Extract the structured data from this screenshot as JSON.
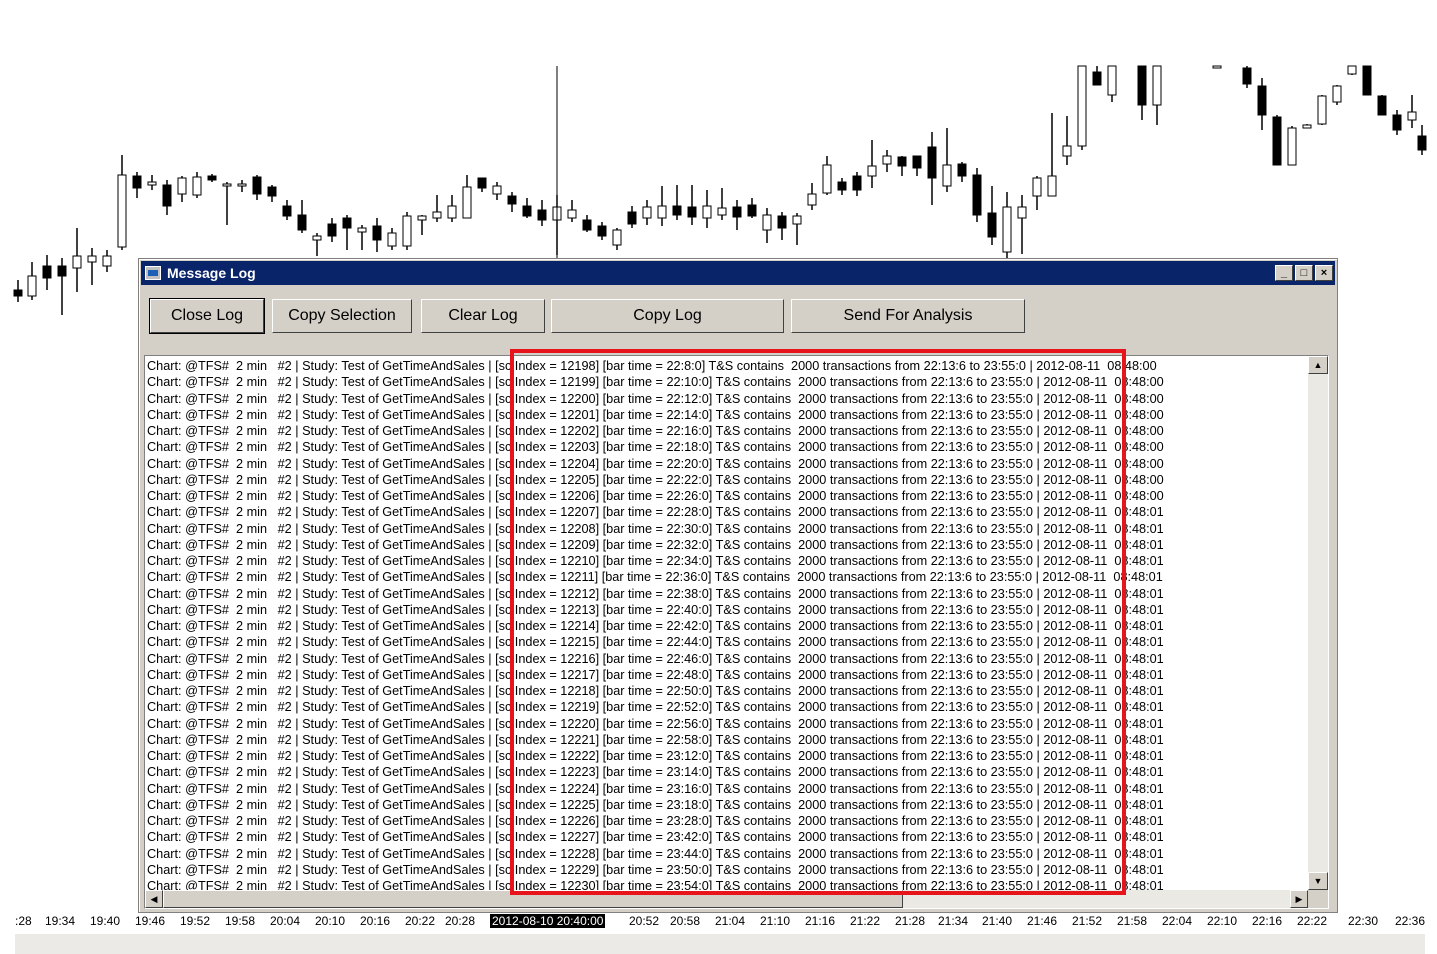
{
  "window": {
    "title": "Message Log",
    "minimize": "_",
    "maximize": "□",
    "close": "×"
  },
  "buttons": {
    "close_log": "Close Log",
    "copy_selection": "Copy Selection",
    "clear_log": "Clear Log",
    "copy_log": "Copy Log",
    "send_for_analysis": "Send For Analysis"
  },
  "scroll": {
    "up": "▲",
    "down": "▼",
    "left": "◀",
    "right": "▶"
  },
  "log": {
    "lines": [
      "Chart: @TFS#  2 min   #2 | Study: Test of GetTimeAndSales | [sc.Index = 12198] [bar time = 22:8:0] T&S contains  2000 transactions from 22:13:6 to 23:55:0 | 2012-08-11  08:48:00",
      "Chart: @TFS#  2 min   #2 | Study: Test of GetTimeAndSales | [sc.Index = 12199] [bar time = 22:10:0] T&S contains  2000 transactions from 22:13:6 to 23:55:0 | 2012-08-11  08:48:00",
      "Chart: @TFS#  2 min   #2 | Study: Test of GetTimeAndSales | [sc.Index = 12200] [bar time = 22:12:0] T&S contains  2000 transactions from 22:13:6 to 23:55:0 | 2012-08-11  08:48:00",
      "Chart: @TFS#  2 min   #2 | Study: Test of GetTimeAndSales | [sc.Index = 12201] [bar time = 22:14:0] T&S contains  2000 transactions from 22:13:6 to 23:55:0 | 2012-08-11  08:48:00",
      "Chart: @TFS#  2 min   #2 | Study: Test of GetTimeAndSales | [sc.Index = 12202] [bar time = 22:16:0] T&S contains  2000 transactions from 22:13:6 to 23:55:0 | 2012-08-11  08:48:00",
      "Chart: @TFS#  2 min   #2 | Study: Test of GetTimeAndSales | [sc.Index = 12203] [bar time = 22:18:0] T&S contains  2000 transactions from 22:13:6 to 23:55:0 | 2012-08-11  08:48:00",
      "Chart: @TFS#  2 min   #2 | Study: Test of GetTimeAndSales | [sc.Index = 12204] [bar time = 22:20:0] T&S contains  2000 transactions from 22:13:6 to 23:55:0 | 2012-08-11  08:48:00",
      "Chart: @TFS#  2 min   #2 | Study: Test of GetTimeAndSales | [sc.Index = 12205] [bar time = 22:22:0] T&S contains  2000 transactions from 22:13:6 to 23:55:0 | 2012-08-11  08:48:00",
      "Chart: @TFS#  2 min   #2 | Study: Test of GetTimeAndSales | [sc.Index = 12206] [bar time = 22:26:0] T&S contains  2000 transactions from 22:13:6 to 23:55:0 | 2012-08-11  08:48:00",
      "Chart: @TFS#  2 min   #2 | Study: Test of GetTimeAndSales | [sc.Index = 12207] [bar time = 22:28:0] T&S contains  2000 transactions from 22:13:6 to 23:55:0 | 2012-08-11  08:48:01",
      "Chart: @TFS#  2 min   #2 | Study: Test of GetTimeAndSales | [sc.Index = 12208] [bar time = 22:30:0] T&S contains  2000 transactions from 22:13:6 to 23:55:0 | 2012-08-11  08:48:01",
      "Chart: @TFS#  2 min   #2 | Study: Test of GetTimeAndSales | [sc.Index = 12209] [bar time = 22:32:0] T&S contains  2000 transactions from 22:13:6 to 23:55:0 | 2012-08-11  08:48:01",
      "Chart: @TFS#  2 min   #2 | Study: Test of GetTimeAndSales | [sc.Index = 12210] [bar time = 22:34:0] T&S contains  2000 transactions from 22:13:6 to 23:55:0 | 2012-08-11  08:48:01",
      "Chart: @TFS#  2 min   #2 | Study: Test of GetTimeAndSales | [sc.Index = 12211] [bar time = 22:36:0] T&S contains  2000 transactions from 22:13:6 to 23:55:0 | 2012-08-11  08:48:01",
      "Chart: @TFS#  2 min   #2 | Study: Test of GetTimeAndSales | [sc.Index = 12212] [bar time = 22:38:0] T&S contains  2000 transactions from 22:13:6 to 23:55:0 | 2012-08-11  08:48:01",
      "Chart: @TFS#  2 min   #2 | Study: Test of GetTimeAndSales | [sc.Index = 12213] [bar time = 22:40:0] T&S contains  2000 transactions from 22:13:6 to 23:55:0 | 2012-08-11  08:48:01",
      "Chart: @TFS#  2 min   #2 | Study: Test of GetTimeAndSales | [sc.Index = 12214] [bar time = 22:42:0] T&S contains  2000 transactions from 22:13:6 to 23:55:0 | 2012-08-11  08:48:01",
      "Chart: @TFS#  2 min   #2 | Study: Test of GetTimeAndSales | [sc.Index = 12215] [bar time = 22:44:0] T&S contains  2000 transactions from 22:13:6 to 23:55:0 | 2012-08-11  08:48:01",
      "Chart: @TFS#  2 min   #2 | Study: Test of GetTimeAndSales | [sc.Index = 12216] [bar time = 22:46:0] T&S contains  2000 transactions from 22:13:6 to 23:55:0 | 2012-08-11  08:48:01",
      "Chart: @TFS#  2 min   #2 | Study: Test of GetTimeAndSales | [sc.Index = 12217] [bar time = 22:48:0] T&S contains  2000 transactions from 22:13:6 to 23:55:0 | 2012-08-11  08:48:01",
      "Chart: @TFS#  2 min   #2 | Study: Test of GetTimeAndSales | [sc.Index = 12218] [bar time = 22:50:0] T&S contains  2000 transactions from 22:13:6 to 23:55:0 | 2012-08-11  08:48:01",
      "Chart: @TFS#  2 min   #2 | Study: Test of GetTimeAndSales | [sc.Index = 12219] [bar time = 22:52:0] T&S contains  2000 transactions from 22:13:6 to 23:55:0 | 2012-08-11  08:48:01",
      "Chart: @TFS#  2 min   #2 | Study: Test of GetTimeAndSales | [sc.Index = 12220] [bar time = 22:56:0] T&S contains  2000 transactions from 22:13:6 to 23:55:0 | 2012-08-11  08:48:01",
      "Chart: @TFS#  2 min   #2 | Study: Test of GetTimeAndSales | [sc.Index = 12221] [bar time = 22:58:0] T&S contains  2000 transactions from 22:13:6 to 23:55:0 | 2012-08-11  08:48:01",
      "Chart: @TFS#  2 min   #2 | Study: Test of GetTimeAndSales | [sc.Index = 12222] [bar time = 23:12:0] T&S contains  2000 transactions from 22:13:6 to 23:55:0 | 2012-08-11  08:48:01",
      "Chart: @TFS#  2 min   #2 | Study: Test of GetTimeAndSales | [sc.Index = 12223] [bar time = 23:14:0] T&S contains  2000 transactions from 22:13:6 to 23:55:0 | 2012-08-11  08:48:01",
      "Chart: @TFS#  2 min   #2 | Study: Test of GetTimeAndSales | [sc.Index = 12224] [bar time = 23:16:0] T&S contains  2000 transactions from 22:13:6 to 23:55:0 | 2012-08-11  08:48:01",
      "Chart: @TFS#  2 min   #2 | Study: Test of GetTimeAndSales | [sc.Index = 12225] [bar time = 23:18:0] T&S contains  2000 transactions from 22:13:6 to 23:55:0 | 2012-08-11  08:48:01",
      "Chart: @TFS#  2 min   #2 | Study: Test of GetTimeAndSales | [sc.Index = 12226] [bar time = 23:28:0] T&S contains  2000 transactions from 22:13:6 to 23:55:0 | 2012-08-11  08:48:01",
      "Chart: @TFS#  2 min   #2 | Study: Test of GetTimeAndSales | [sc.Index = 12227] [bar time = 23:42:0] T&S contains  2000 transactions from 22:13:6 to 23:55:0 | 2012-08-11  08:48:01",
      "Chart: @TFS#  2 min   #2 | Study: Test of GetTimeAndSales | [sc.Index = 12228] [bar time = 23:44:0] T&S contains  2000 transactions from 22:13:6 to 23:55:0 | 2012-08-11  08:48:01",
      "Chart: @TFS#  2 min   #2 | Study: Test of GetTimeAndSales | [sc.Index = 12229] [bar time = 23:50:0] T&S contains  2000 transactions from 22:13:6 to 23:55:0 | 2012-08-11  08:48:01",
      "Chart: @TFS#  2 min   #2 | Study: Test of GetTimeAndSales | [sc.Index = 12230] [bar time = 23:54:0] T&S contains  2000 transactions from 22:13:6 to 23:55:0 | 2012-08-11  08:48:01"
    ]
  },
  "time_axis": {
    "labels": [
      ":28",
      "19:34",
      "19:40",
      "19:46",
      "19:52",
      "19:58",
      "20:04",
      "20:10",
      "20:16",
      "20:22",
      "20:28",
      "2012-08-10  20:40:00",
      "20:52",
      "20:58",
      "21:04",
      "21:10",
      "21:16",
      "21:22",
      "21:28",
      "21:34",
      "21:40",
      "21:46",
      "21:52",
      "21:58",
      "22:04",
      "22:10",
      "22:16",
      "22:22",
      "22:30",
      "22:36"
    ],
    "highlighted": "2012-08-10  20:40:00"
  },
  "colors": {
    "title_bar": "#0a246a",
    "window_face": "#d4d0c8",
    "highlight_box": "#e8141b"
  }
}
